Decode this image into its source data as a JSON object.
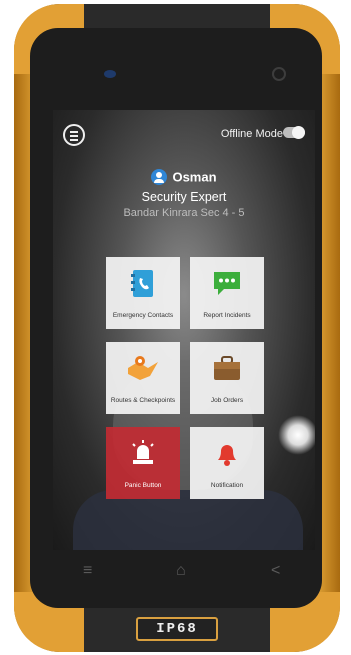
{
  "header": {
    "offline_mode_label": "Offline Mode",
    "offline_mode_on": false
  },
  "user": {
    "name": "Osman",
    "role": "Security Expert",
    "location": "Bandar Kinrara Sec 4 - 5"
  },
  "tiles": [
    {
      "label": "Emergency Contacts",
      "icon": "contacts-book-icon"
    },
    {
      "label": "Report Incidents",
      "icon": "chat-bubble-icon"
    },
    {
      "label": "Routes & Checkpoints",
      "icon": "map-route-icon"
    },
    {
      "label": "Job Orders",
      "icon": "briefcase-icon"
    },
    {
      "label": "Panic Button",
      "icon": "siren-icon"
    },
    {
      "label": "Notification",
      "icon": "bell-icon"
    }
  ],
  "nav": {
    "menu": "≡",
    "home": "⌂",
    "back": "<"
  },
  "device": {
    "badge": "IP68"
  },
  "colors": {
    "panic": "#c22b33",
    "accent": "#2f86d6",
    "frame": "#e2a035"
  }
}
